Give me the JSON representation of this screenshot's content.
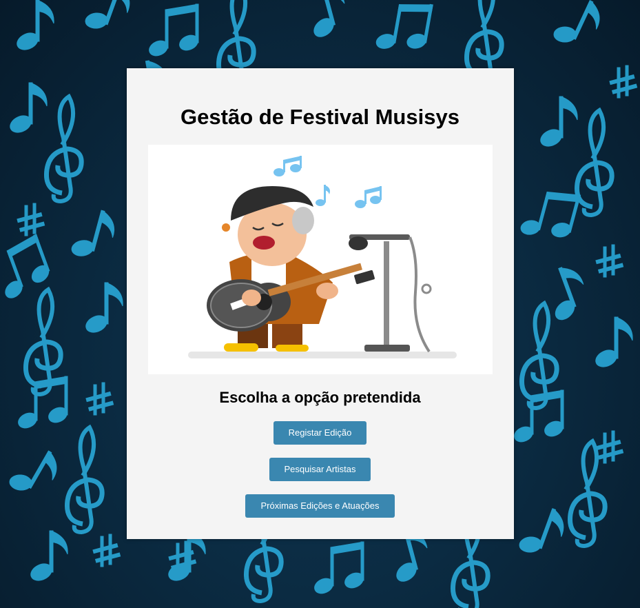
{
  "page": {
    "title": "Gestão de Festival Musisys",
    "subtitle": "Escolha a opção pretendida"
  },
  "illustration": {
    "icon": "singer-with-guitar-illustration"
  },
  "buttons": {
    "register_edition": "Registar Edição",
    "search_artists": "Pesquisar Artistas",
    "upcoming_editions": "Próximas Edições e Atuações"
  },
  "colors": {
    "background": "#0b2b42",
    "notes": "#2fb4e0",
    "card": "#f4f4f4",
    "button": "#3a87b0",
    "button_text": "#ffffff"
  },
  "background": {
    "icon": "music-notes-pattern"
  }
}
